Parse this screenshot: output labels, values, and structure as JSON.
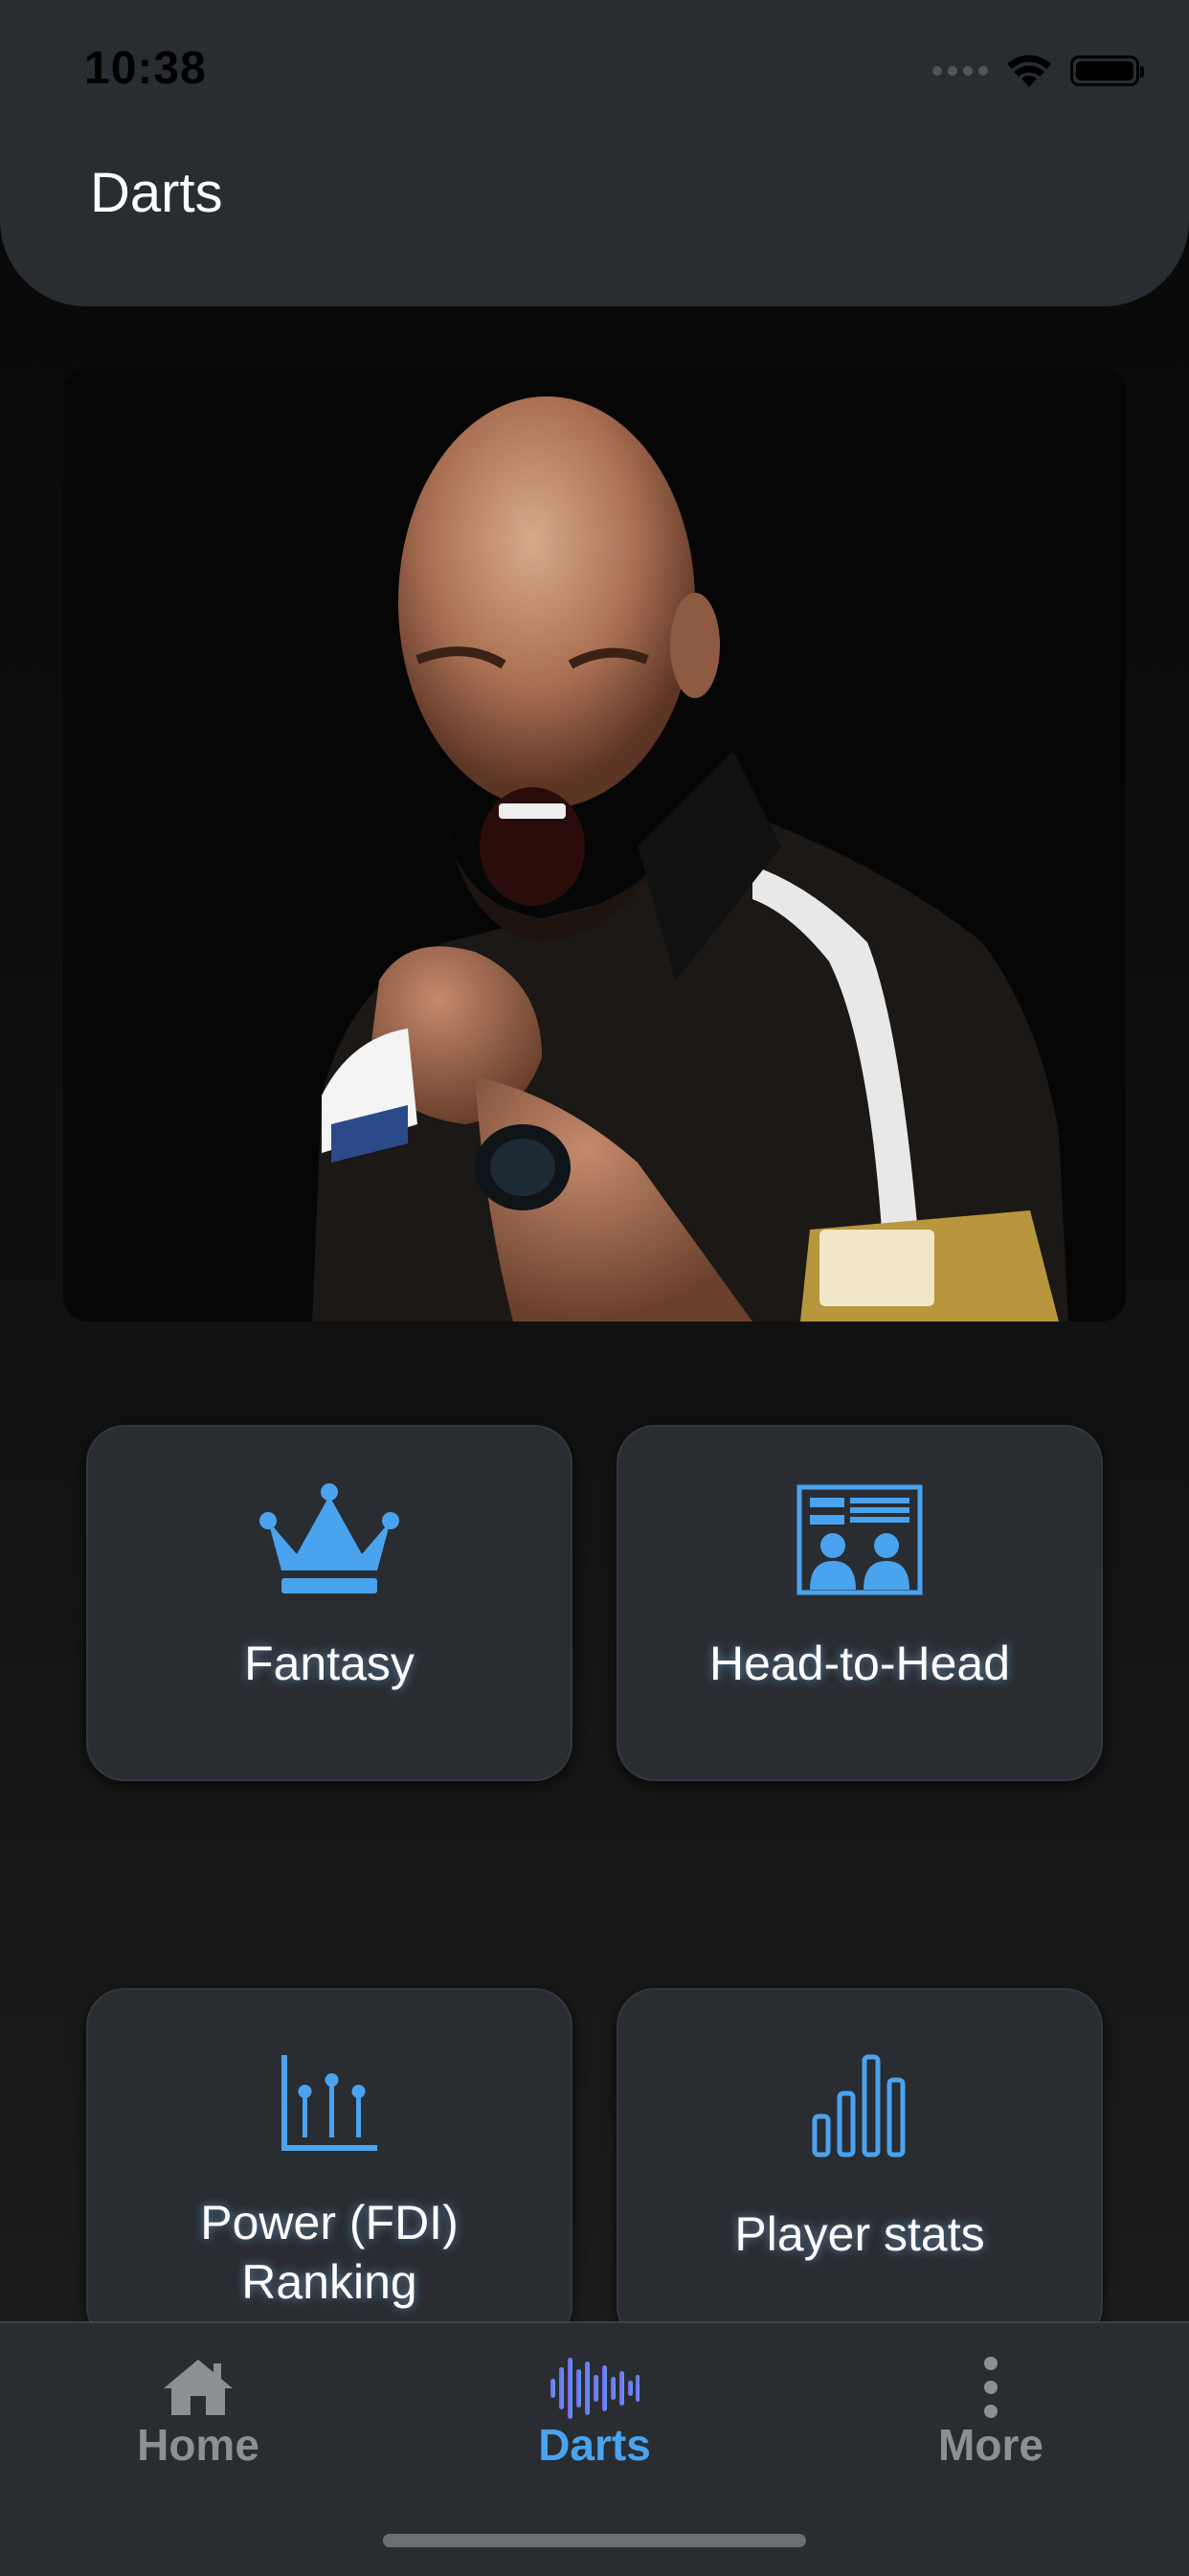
{
  "status_bar": {
    "time": "10:38"
  },
  "header": {
    "title": "Darts"
  },
  "hero": {
    "image_desc": "player-photo"
  },
  "cards": [
    {
      "label": "Fantasy",
      "icon": "crown-icon"
    },
    {
      "label": "Head-to-Head",
      "icon": "head-to-head-icon"
    },
    {
      "label": "Power (FDI)\nRanking",
      "icon": "ranking-icon"
    },
    {
      "label": "Player stats",
      "icon": "bar-chart-icon"
    }
  ],
  "tabbar": {
    "items": [
      {
        "label": "Home",
        "icon": "home-icon",
        "color": "#8c8f93"
      },
      {
        "label": "Darts",
        "icon": "sound-wave-icon",
        "color": "#4aa3ee",
        "active": true
      },
      {
        "label": "More",
        "icon": "more-dots-icon",
        "color": "#8c8f93"
      }
    ]
  },
  "colors": {
    "accent": "#4aa3ee",
    "card_bg": "#292d32",
    "header_bg": "#292d32"
  }
}
